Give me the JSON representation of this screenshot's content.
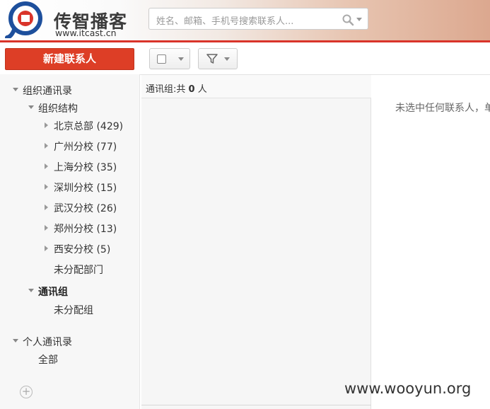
{
  "brand": {
    "title": "传智播客",
    "url": "www.itcast.cn",
    "accent": "#d9342a",
    "logo_icon": "itcast-logo-icon"
  },
  "search": {
    "placeholder": "姓名、邮箱、手机号搜索联系人..."
  },
  "new_contact_label": "新建联系人",
  "toolbar": {
    "select_all_icon": "checkbox-icon",
    "filter_icon": "filter-icon"
  },
  "tree": {
    "org_root": "组织通讯录",
    "org_structure": "组织结构",
    "branches": [
      {
        "name": "北京总部",
        "count": "(429)"
      },
      {
        "name": "广州分校",
        "count": "(77)"
      },
      {
        "name": "上海分校",
        "count": "(35)"
      },
      {
        "name": "深圳分校",
        "count": "(15)"
      },
      {
        "name": "武汉分校",
        "count": "(26)"
      },
      {
        "name": "郑州分校",
        "count": "(13)"
      },
      {
        "name": "西安分校",
        "count": "(5)"
      }
    ],
    "unassigned_dept": "未分配部门",
    "groups": "通讯组",
    "unassigned_group": "未分配组",
    "personal": "个人通讯录",
    "all": "全部"
  },
  "list": {
    "prefix": "通讯组:共",
    "count": "0",
    "suffix": "人"
  },
  "detail": {
    "empty_message": "未选中任何联系人，单"
  },
  "watermark": "www.wooyun.org"
}
